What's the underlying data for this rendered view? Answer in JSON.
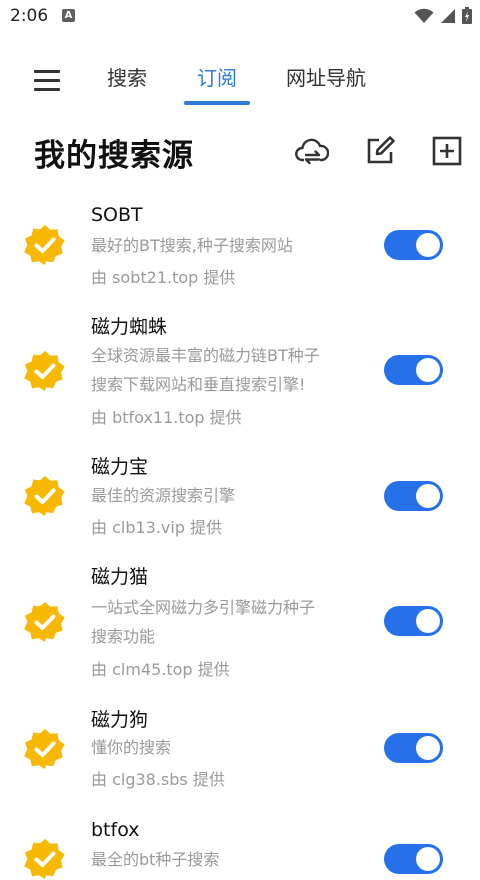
{
  "status": {
    "time": "2:06",
    "notification_glyph": "A"
  },
  "nav": {
    "tabs": [
      {
        "label": "搜索"
      },
      {
        "label": "订阅"
      },
      {
        "label": "网址导航"
      }
    ],
    "active_tab": "订阅"
  },
  "header": {
    "title": "我的搜索源"
  },
  "icons": {
    "accent": "#2f7bd8",
    "badge_color": "#f6b800",
    "toggle_on_color": "#2670e9"
  },
  "sources": [
    {
      "name": "SOBT",
      "desc_lines": [
        "最好的BT搜索,种子搜索网站"
      ],
      "provider": "由 sobt21.top 提供",
      "enabled": true
    },
    {
      "name": "磁力蜘蛛",
      "desc_lines": [
        "全球资源最丰富的磁力链BT种子",
        "搜索下载网站和垂直搜索引擎!"
      ],
      "provider": "由 btfox11.top 提供",
      "enabled": true
    },
    {
      "name": "磁力宝",
      "desc_lines": [
        "最佳的资源搜索引擎"
      ],
      "provider": "由 clb13.vip 提供",
      "enabled": true
    },
    {
      "name": "磁力猫",
      "desc_lines": [
        "一站式全网磁力多引擎磁力种子",
        "搜索功能"
      ],
      "provider": "由 clm45.top 提供",
      "enabled": true
    },
    {
      "name": "磁力狗",
      "desc_lines": [
        "懂你的搜索"
      ],
      "provider": "由 clg38.sbs 提供",
      "enabled": true
    },
    {
      "name": "btfox",
      "desc_lines": [
        "最全的bt种子搜索"
      ],
      "provider": "",
      "enabled": true
    }
  ]
}
